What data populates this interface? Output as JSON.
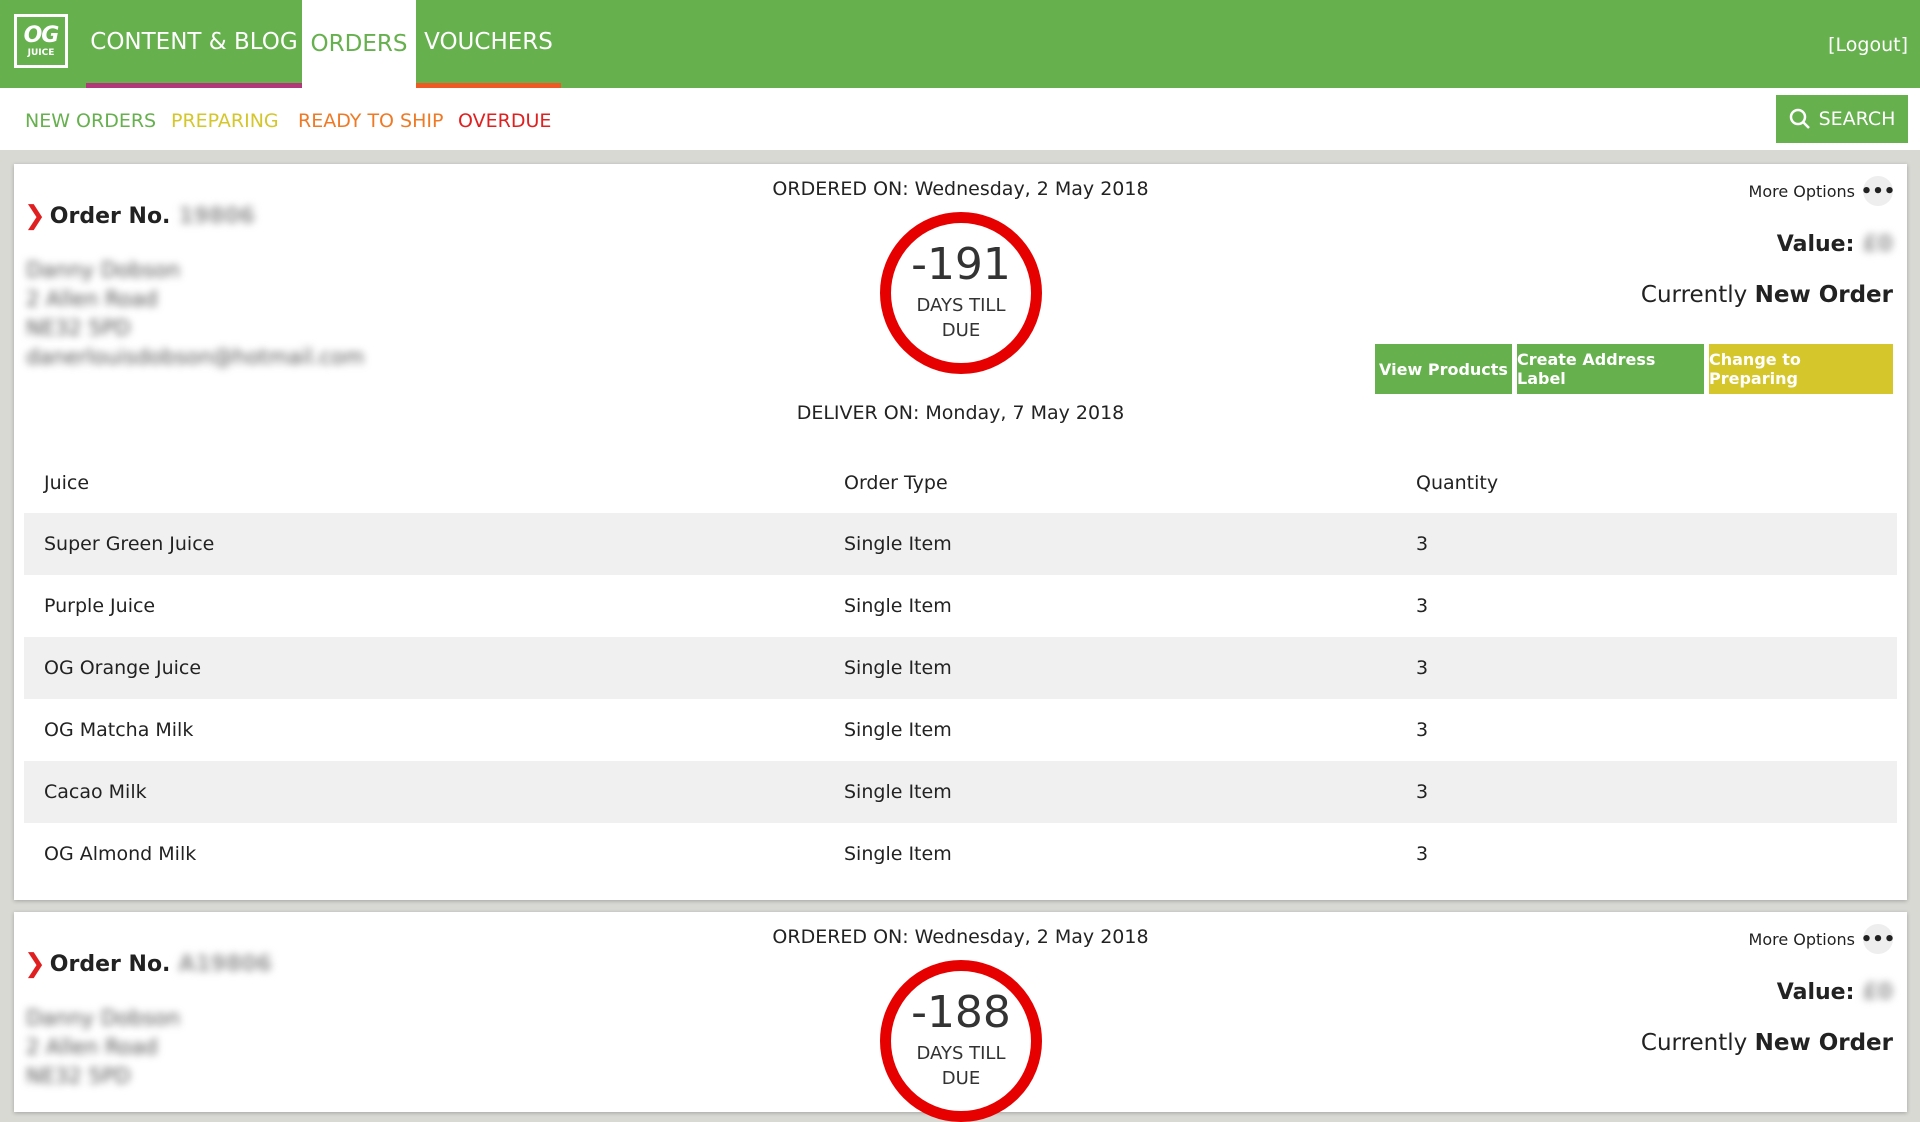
{
  "header": {
    "logo": {
      "top": "OG",
      "bottom": "JUICE"
    },
    "tabs": [
      "CONTENT & BLOG",
      "ORDERS",
      "VOUCHERS"
    ],
    "logout": "[Logout]"
  },
  "subnav": {
    "items": [
      "NEW ORDERS",
      "PREPARING",
      "READY TO SHIP",
      "OVERDUE"
    ],
    "search": "SEARCH"
  },
  "colors": {
    "brand_green": "#66b04e",
    "preparing_yellow": "#d5c62b",
    "ready_orange": "#ef7a26",
    "overdue_red": "#e02020"
  },
  "orders": [
    {
      "ordered_on": "ORDERED ON: Wednesday, 2 May 2018",
      "order_label": "Order No.",
      "order_id": "19806",
      "customer": [
        "Danny Dobson",
        "2 Allen Road",
        "NE32 5PD",
        "danerlouisdobson@hotmail.com"
      ],
      "days_till_due": "-191",
      "days_label_1": "DAYS TILL",
      "days_label_2": "DUE",
      "deliver_on": "DELIVER ON: Monday, 7 May 2018",
      "more_options": "More Options",
      "value_label": "Value:",
      "value_amount": "£0",
      "status_prefix": "Currently",
      "status": "New Order",
      "actions": [
        "View Products",
        "Create Address Label",
        "Change to Preparing"
      ],
      "table": {
        "columns": [
          "Juice",
          "Order Type",
          "Quantity"
        ],
        "rows": [
          [
            "Super Green Juice",
            "Single Item",
            "3"
          ],
          [
            "Purple Juice",
            "Single Item",
            "3"
          ],
          [
            "OG Orange Juice",
            "Single Item",
            "3"
          ],
          [
            "OG Matcha Milk",
            "Single Item",
            "3"
          ],
          [
            "Cacao Milk",
            "Single Item",
            "3"
          ],
          [
            "OG Almond Milk",
            "Single Item",
            "3"
          ]
        ]
      }
    },
    {
      "ordered_on": "ORDERED ON: Wednesday, 2 May 2018",
      "order_label": "Order No.",
      "order_id": "A19806",
      "customer": [
        "Danny Dobson",
        "2 Allen Road",
        "NE32 5PD"
      ],
      "days_till_due": "-188",
      "days_label_1": "DAYS TILL",
      "days_label_2": "DUE",
      "more_options": "More Options",
      "value_label": "Value:",
      "value_amount": "£0",
      "status_prefix": "Currently",
      "status": "New Order"
    }
  ]
}
